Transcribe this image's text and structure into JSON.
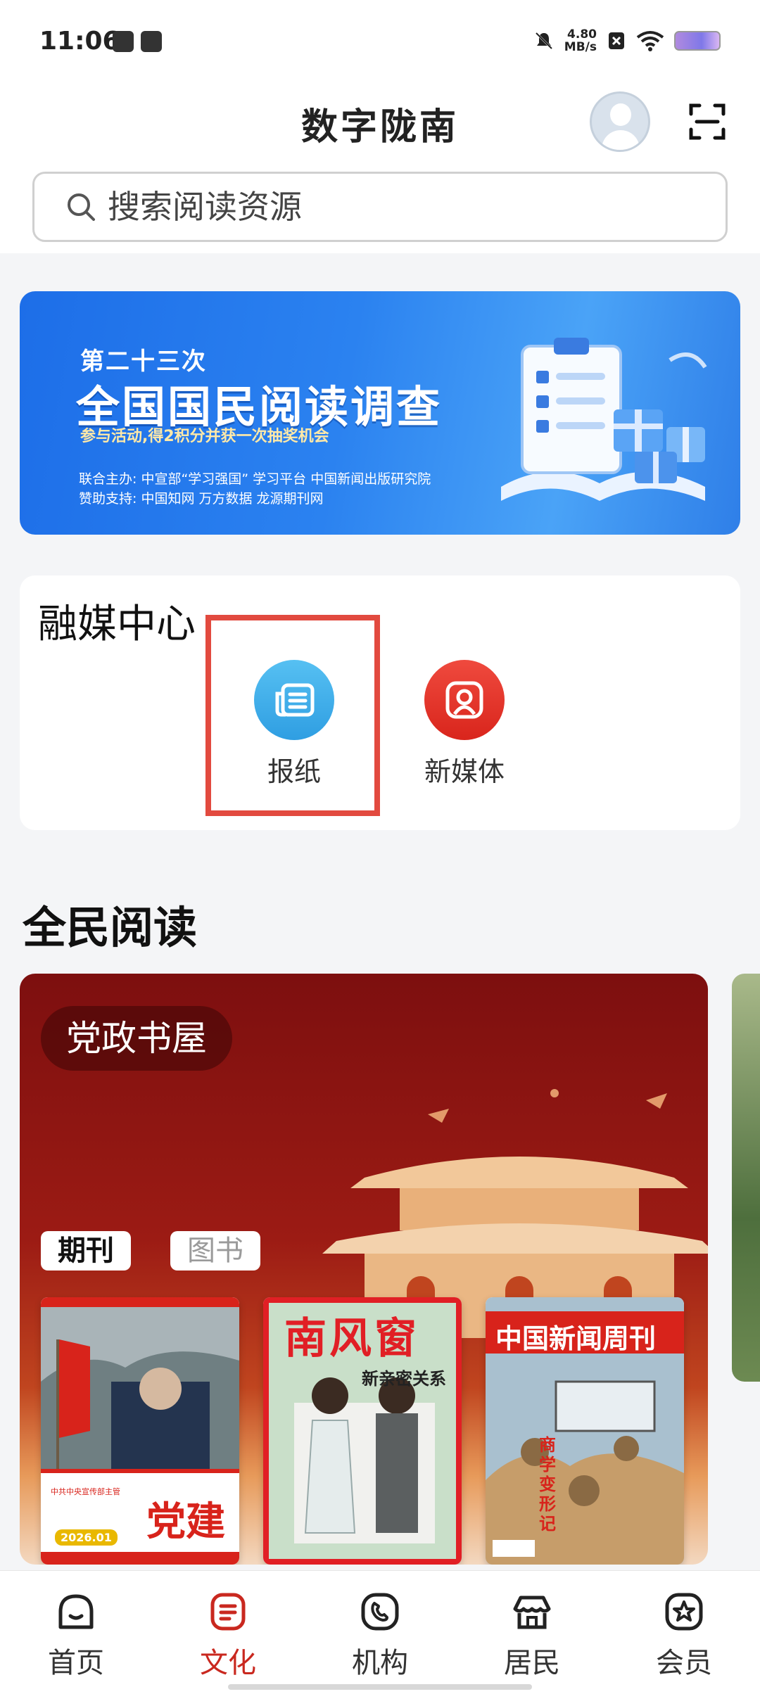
{
  "status_bar": {
    "time": "11:06",
    "net_speed_value": "4.80",
    "net_speed_unit": "MB/s"
  },
  "header": {
    "title": "数字陇南",
    "search_placeholder": "搜索阅读资源"
  },
  "banner": {
    "sub_title": "第二十三次",
    "title": "全国国民阅读调查",
    "tagline": "参与活动,得2积分并获一次抽奖机会",
    "organizers": "联合主办: 中宣部“学习强国” 学习平台 中国新闻出版研究院",
    "sponsors": "赞助支持: 中国知网 万方数据 龙源期刊网"
  },
  "media_center": {
    "title": "融媒中心",
    "items": [
      {
        "label": "报纸"
      },
      {
        "label": "新媒体"
      }
    ]
  },
  "reading": {
    "title": "全民阅读",
    "card_tag": "党政书屋",
    "tabs": [
      {
        "label": "期刊",
        "active": true
      },
      {
        "label": "图书",
        "active": false
      }
    ],
    "books": [
      {
        "cover_title": "党建",
        "cover_caption": "中共中央宣传部主管",
        "issue": "2026.01"
      },
      {
        "cover_title": "南风窗",
        "cover_subtitle": "新亲密关系"
      },
      {
        "cover_title": "中国新闻周刊",
        "cover_subtitle": "商学变形记"
      }
    ]
  },
  "bottom_nav": {
    "items": [
      {
        "label": "首页",
        "icon": "home-icon",
        "active": false
      },
      {
        "label": "文化",
        "icon": "culture-icon",
        "active": true
      },
      {
        "label": "机构",
        "icon": "institution-icon",
        "active": false
      },
      {
        "label": "居民",
        "icon": "resident-icon",
        "active": false
      },
      {
        "label": "会员",
        "icon": "member-icon",
        "active": false
      }
    ]
  },
  "colors": {
    "accent": "#c9281f",
    "highlight_box": "#e24a3f",
    "banner_blue": "#2b82f0"
  }
}
